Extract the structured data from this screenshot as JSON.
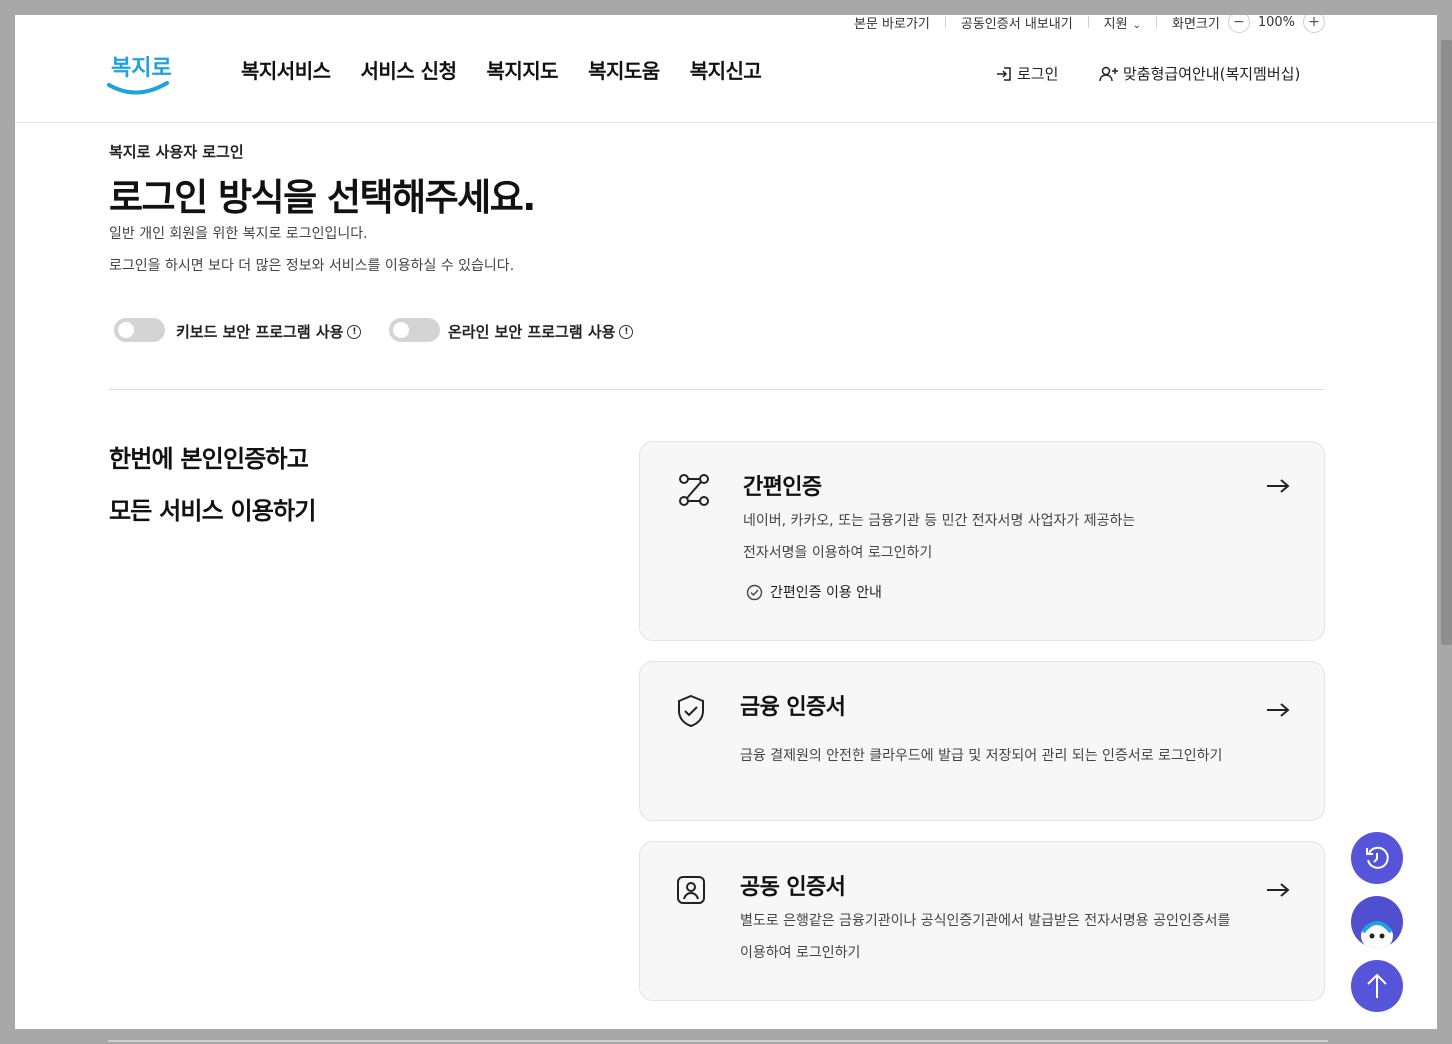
{
  "util": {
    "skip": "본문 바로가기",
    "cert_export": "공동인증서 내보내기",
    "support": "지원",
    "screen_size": "화면크기",
    "zoom": "100%"
  },
  "brand": {
    "logo_text": "복지로"
  },
  "gnb": [
    "복지서비스",
    "서비스 신청",
    "복지지도",
    "복지도움",
    "복지신고"
  ],
  "header": {
    "login": "로그인",
    "membership": "맞춤형급여안내(복지멤버십)"
  },
  "page": {
    "subtitle": "복지로 사용자 로그인",
    "title": "로그인 방식을 선택해주세요.",
    "desc1": "일반 개인 회원을 위한 복지로 로그인입니다.",
    "desc2": "로그인을 하시면 보다 더 많은 정보와 서비스를 이용하실 수 있습니다."
  },
  "toggles": [
    {
      "label": "키보드 보안 프로그램 사용",
      "on": false
    },
    {
      "label": "온라인 보안 프로그램 사용",
      "on": false
    }
  ],
  "left": {
    "line1": "한번에 본인인증하고",
    "line2": "모든 서비스 이용하기"
  },
  "cards": [
    {
      "title": "간편인증",
      "desc1": "네이버, 카카오, 또는 금융기관 등 민간 전자서명 사업자가 제공하는",
      "desc2": "전자서명을 이용하여 로그인하기",
      "guide": "간편인증 이용 안내",
      "icon": "route-icon"
    },
    {
      "title": "금융 인증서",
      "desc1": "금융 결제원의 안전한 클라우드에 발급 및 저장되어 관리 되는 인증서로 로그인하기",
      "icon": "shield-check-icon"
    },
    {
      "title": "공동 인증서",
      "desc1": "별도로 은행같은 금융기관이나 공식인증기관에서 발급받은 전자서명용 공인인증서를",
      "desc2": "이용하여 로그인하기",
      "icon": "user-badge-icon"
    }
  ],
  "colors": {
    "accent": "#5654d9",
    "logo_blue": "#1fa3e0",
    "card_bg": "#f7f7f7"
  }
}
